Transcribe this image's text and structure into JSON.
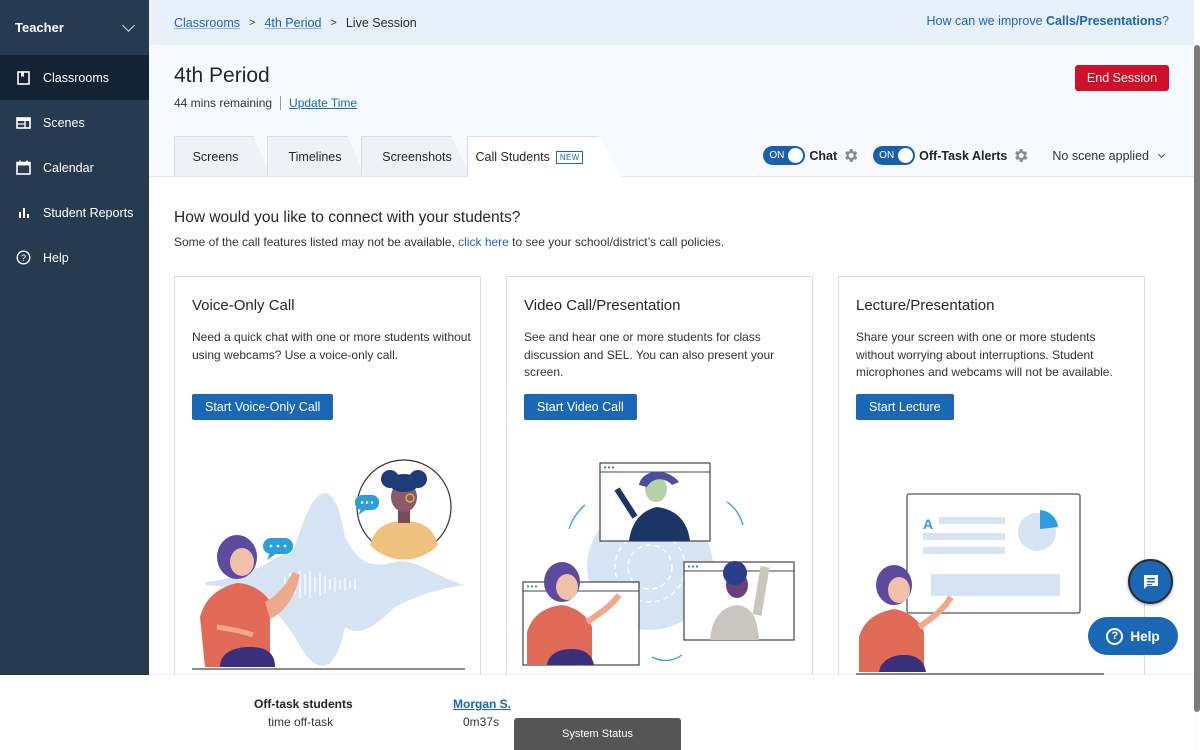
{
  "sidebar": {
    "role": "Teacher",
    "items": [
      {
        "label": "Classrooms",
        "icon": "notebook-icon",
        "active": true
      },
      {
        "label": "Scenes",
        "icon": "scenes-icon",
        "active": false
      },
      {
        "label": "Calendar",
        "icon": "calendar-icon",
        "active": false
      },
      {
        "label": "Student Reports",
        "icon": "bar-chart-icon",
        "active": false
      },
      {
        "label": "Help",
        "icon": "help-circle-icon",
        "active": false
      }
    ]
  },
  "breadcrumb": {
    "items": [
      "Classrooms",
      "4th Period"
    ],
    "current": "Live Session"
  },
  "feedback": {
    "prefix": "How can we improve ",
    "bold": "Calls/Presentations",
    "suffix": "?"
  },
  "header": {
    "title": "4th Period",
    "time_remaining": "44 mins remaining",
    "update_time": "Update Time",
    "end_session": "End Session"
  },
  "tabs": [
    {
      "label": "Screens",
      "active": false
    },
    {
      "label": "Timelines",
      "active": false
    },
    {
      "label": "Screenshots",
      "active": false
    },
    {
      "label": "Call Students",
      "active": true,
      "badge": "NEW"
    }
  ],
  "controls": {
    "chat": {
      "toggle": "ON",
      "label": "Chat"
    },
    "off_task": {
      "toggle": "ON",
      "label": "Off-Task Alerts"
    },
    "scene": "No scene applied"
  },
  "main": {
    "question": "How would you like to connect with your students?",
    "policy_prefix": "Some of the call features listed may not be available, ",
    "policy_link": "click here",
    "policy_suffix": " to see your school/district’s call policies.",
    "cards": [
      {
        "title": "Voice-Only Call",
        "description": "Need a quick chat with one or more students without using webcams? Use a voice-only call.",
        "button": "Start Voice-Only Call"
      },
      {
        "title": "Video Call/Presentation",
        "description": "See and hear one or more students for class discussion and SEL. You can also present your screen.",
        "button": "Start Video Call"
      },
      {
        "title": "Lecture/Presentation",
        "description": "Share your screen with one or more students without worrying about interruptions. Student microphones and webcams will not be available.",
        "button": "Start Lecture"
      }
    ]
  },
  "floating": {
    "help_label": "Help",
    "help_glyph": "?"
  },
  "bottom": {
    "offtask_heading": "Off-task students",
    "offtask_sub": "time off-task",
    "student_name": "Morgan S.",
    "student_time": "0m37s",
    "system_status": "System Status"
  },
  "colors": {
    "sidebar_bg": "#263b4f",
    "sidebar_active": "#142333",
    "primary": "#1a67b5",
    "danger": "#d0102a",
    "breadcrumb_bg": "#e7eff9"
  }
}
